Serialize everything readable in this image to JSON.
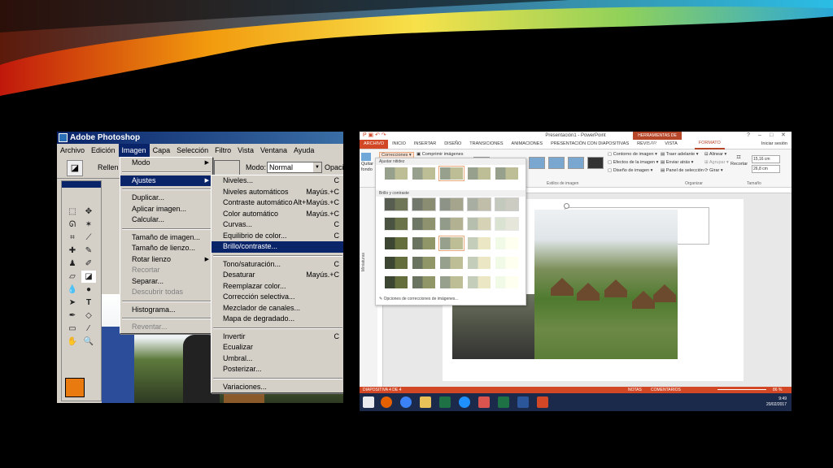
{
  "photoshop": {
    "window_title": "Adobe Photoshop",
    "menubar": [
      "Archivo",
      "Edición",
      "Imagen",
      "Capa",
      "Selección",
      "Filtro",
      "Vista",
      "Ventana",
      "Ayuda"
    ],
    "options": {
      "fill_label": "Rellen",
      "mode_label": "Modo:",
      "mode_value": "Normal",
      "opacity_label": "Opaci"
    },
    "imagen_menu": [
      {
        "label": "Modo",
        "submenu": true
      },
      {
        "separator": true
      },
      {
        "label": "Ajustes",
        "submenu": true,
        "highlight": true
      },
      {
        "separator": true
      },
      {
        "label": "Duplicar..."
      },
      {
        "label": "Aplicar imagen..."
      },
      {
        "label": "Calcular..."
      },
      {
        "separator": true
      },
      {
        "label": "Tamaño de imagen..."
      },
      {
        "label": "Tamaño de lienzo..."
      },
      {
        "label": "Rotar lienzo",
        "submenu": true
      },
      {
        "label": "Recortar",
        "disabled": true
      },
      {
        "label": "Separar..."
      },
      {
        "label": "Descubrir todas",
        "disabled": true
      },
      {
        "separator": true
      },
      {
        "label": "Histograma..."
      },
      {
        "separator": true
      },
      {
        "label": "Reventar...",
        "disabled": true
      }
    ],
    "ajustes_menu": [
      {
        "label": "Niveles...",
        "shortcut": "C"
      },
      {
        "label": "Niveles automáticos",
        "shortcut": "Mayús.+C"
      },
      {
        "label": "Contraste automático",
        "shortcut": "Alt+Mayús.+C"
      },
      {
        "label": "Color automático",
        "shortcut": "Mayús.+C"
      },
      {
        "label": "Curvas...",
        "shortcut": "C"
      },
      {
        "label": "Equilibrio de color...",
        "shortcut": "C"
      },
      {
        "label": "Brillo/contraste...",
        "highlight": true
      },
      {
        "separator": true
      },
      {
        "label": "Tono/saturación...",
        "shortcut": "C"
      },
      {
        "label": "Desaturar",
        "shortcut": "Mayús.+C"
      },
      {
        "label": "Reemplazar color..."
      },
      {
        "label": "Corrección selectiva..."
      },
      {
        "label": "Mezclador de canales..."
      },
      {
        "label": "Mapa de degradado..."
      },
      {
        "separator": true
      },
      {
        "label": "Invertir",
        "shortcut": "C"
      },
      {
        "label": "Ecualizar"
      },
      {
        "label": "Umbral..."
      },
      {
        "label": "Posterizar..."
      },
      {
        "separator": true
      },
      {
        "label": "Variaciones..."
      }
    ],
    "colors": {
      "foreground": "#e87a10",
      "background": "#2e5a25",
      "highlight": "#0a246a"
    }
  },
  "powerpoint": {
    "window_title": "Presentación1 - PowerPoint",
    "context_tab": "HERRAMIENTAS DE IMAGEN",
    "signin": "Iniciar sesión",
    "tabs": [
      "ARCHIVO",
      "INICIO",
      "INSERTAR",
      "DISEÑO",
      "TRANSICIONES",
      "ANIMACIONES",
      "PRESENTACIÓN CON DIAPOSITIVAS",
      "REVISAR",
      "VISTA",
      "FORMATO"
    ],
    "ribbon": {
      "quitar_fondo": "Quitar fondo",
      "correcciones": "Correcciones",
      "comprimir": "Comprimir imágenes",
      "estilos_label": "Estilos de imagen",
      "contorno": "Contorno de imagen",
      "efectos": "Efectos de la imagen",
      "diseno": "Diseño de imagen",
      "traer": "Traer adelante",
      "enviar": "Enviar atrás",
      "panel": "Panel de selección",
      "alinear": "Alinear",
      "agrupar": "Agrupar",
      "girar": "Girar",
      "organizar_label": "Organizar",
      "recortar": "Recortar",
      "height": "15,16 cm",
      "width": "26,8 cm",
      "tamano_label": "Tamaño"
    },
    "corrections_panel": {
      "section1": "Ajustar nitidez",
      "section2": "Brillo y contraste",
      "footer": "Opciones de correcciones de imágenes..."
    },
    "thumbnails_label": "Miniaturas",
    "status": {
      "slide": "DIAPOSITIVA 4 DE 4",
      "notes": "NOTAS",
      "comments": "COMENTARIOS",
      "zoom": "86 %"
    },
    "clock": {
      "time": "9:49",
      "date": "20/02/2017"
    },
    "accent": "#d24726"
  }
}
